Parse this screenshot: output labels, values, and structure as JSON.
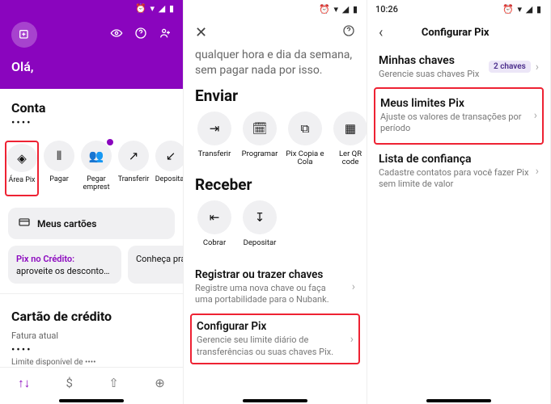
{
  "colors": {
    "accent": "#8a05be",
    "highlight": "#e23"
  },
  "screen1": {
    "status_time": "",
    "greeting": "Olá,",
    "account_title": "Conta",
    "balance_masked": "••••",
    "header_icons": {
      "avatar": "profile-add-icon",
      "i1": "eye-icon",
      "i2": "help-icon",
      "i3": "invite-icon"
    },
    "actions": [
      {
        "icon": "◈",
        "label": "Área Pix",
        "highlighted": true
      },
      {
        "icon": "⦀",
        "label": "Pagar"
      },
      {
        "icon": "👥",
        "label": "Pegar emprest",
        "badge": true
      },
      {
        "icon": "↗",
        "label": "Transferir"
      },
      {
        "icon": "↙",
        "label": "Depositar"
      }
    ],
    "my_cards": {
      "icon": "▭",
      "label": "Meus cartões"
    },
    "promos": [
      {
        "title": "Pix no Crédito:",
        "subtitle": "aproveite os desconto…"
      },
      {
        "title": "",
        "subtitle": "Conheça prática e…"
      }
    ],
    "credit_card": {
      "title": "Cartão de crédito",
      "subtitle": "Fatura atual",
      "value_masked": "••••",
      "limit_text": "Limite disponível de ••••"
    },
    "bottom_nav": [
      "↑↓",
      "$",
      "⇧",
      "⊕"
    ]
  },
  "screen2": {
    "status_time": "",
    "intro_line": "qualquer hora e dia da semana, sem pagar nada por isso.",
    "enviar_title": "Enviar",
    "enviar_actions": [
      {
        "icon": "⇥",
        "label": "Transferir"
      },
      {
        "icon": "🗓",
        "label": "Programar"
      },
      {
        "icon": "⧉",
        "label": "Pix Copia e Cola"
      },
      {
        "icon": "▦",
        "label": "Ler QR code"
      }
    ],
    "receber_title": "Receber",
    "receber_actions": [
      {
        "icon": "⇤",
        "label": "Cobrar"
      },
      {
        "icon": "↧",
        "label": "Depositar"
      }
    ],
    "list": [
      {
        "title": "Registrar ou trazer chaves",
        "subtitle": "Registre uma nova chave ou faça uma portabilidade para o Nubank."
      },
      {
        "title": "Configurar Pix",
        "subtitle": "Gerencie seu limite diário de transferências ou suas chaves Pix.",
        "highlighted": true
      }
    ]
  },
  "screen3": {
    "status_time": "10:26",
    "page_title": "Configurar Pix",
    "my_keys": {
      "title": "Minhas chaves",
      "subtitle": "Gerencie suas chaves Pix",
      "badge": "2 chaves"
    },
    "items": [
      {
        "title": "Meus limites Pix",
        "subtitle": "Ajuste os valores de transações por período",
        "highlighted": true
      },
      {
        "title": "Lista de confiança",
        "subtitle": "Cadastre contatos para você fazer Pix sem limite de valor"
      }
    ]
  }
}
